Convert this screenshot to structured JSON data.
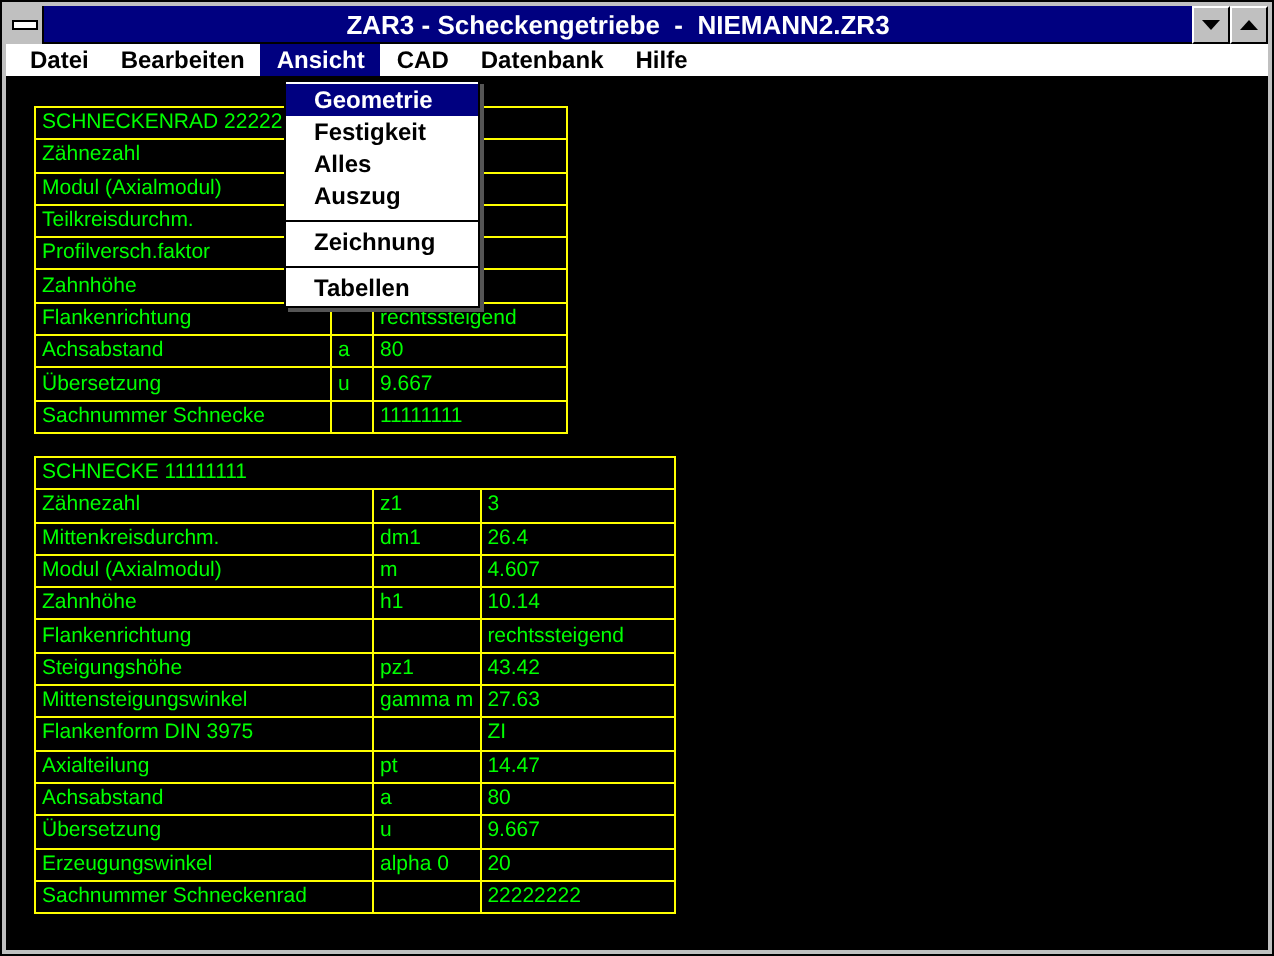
{
  "window": {
    "title": "ZAR3 - Scheckengetriebe  -  NIEMANN2.ZR3"
  },
  "menubar": [
    {
      "label": "Datei",
      "selected": false
    },
    {
      "label": "Bearbeiten",
      "selected": false
    },
    {
      "label": "Ansicht",
      "selected": true
    },
    {
      "label": "CAD",
      "selected": false
    },
    {
      "label": "Datenbank",
      "selected": false
    },
    {
      "label": "Hilfe",
      "selected": false
    }
  ],
  "dropdown": [
    {
      "label": "Geometrie",
      "selected": true,
      "separator_before": false
    },
    {
      "label": "Festigkeit",
      "selected": false,
      "separator_before": false
    },
    {
      "label": "Alles",
      "selected": false,
      "separator_before": false
    },
    {
      "label": "Auszug",
      "selected": false,
      "separator_before": false
    },
    {
      "label": "Zeichnung",
      "selected": false,
      "separator_before": true
    },
    {
      "label": "Tabellen",
      "selected": false,
      "separator_before": true
    }
  ],
  "tables": [
    {
      "title": "SCHNECKENRAD 22222",
      "rows": [
        [
          "Zähnezahl",
          "",
          ""
        ],
        [
          "Modul (Axialmodul)",
          "",
          ""
        ],
        [
          "Teilkreisdurchm.",
          "",
          ""
        ],
        [
          "Profilversch.faktor",
          "",
          ""
        ],
        [
          "Zahnhöhe",
          "",
          ""
        ],
        [
          "Flankenrichtung",
          "",
          "rechtssteigend"
        ],
        [
          "Achsabstand",
          "a",
          "80"
        ],
        [
          "Übersetzung",
          "u",
          "9.667"
        ],
        [
          "Sachnummer Schnecke",
          "",
          "11111111"
        ]
      ]
    },
    {
      "title": "SCHNECKE 11111111",
      "rows": [
        [
          "Zähnezahl",
          "z1",
          "3"
        ],
        [
          "Mittenkreisdurchm.",
          "dm1",
          "26.4"
        ],
        [
          "Modul (Axialmodul)",
          "m",
          "4.607"
        ],
        [
          "Zahnhöhe",
          "h1",
          "10.14"
        ],
        [
          "Flankenrichtung",
          "",
          "rechtssteigend"
        ],
        [
          "Steigungshöhe",
          "pz1",
          "43.42"
        ],
        [
          "Mittensteigungswinkel",
          "gamma m",
          "27.63"
        ],
        [
          "Flankenform DIN 3975",
          "",
          "ZI"
        ],
        [
          "Axialteilung",
          "pt",
          "14.47"
        ],
        [
          "Achsabstand",
          "a",
          "80"
        ],
        [
          "Übersetzung",
          "u",
          "9.667"
        ],
        [
          "Erzeugungswinkel",
          "alpha 0",
          "20"
        ],
        [
          "Sachnummer Schneckenrad",
          "",
          "22222222"
        ]
      ]
    }
  ]
}
